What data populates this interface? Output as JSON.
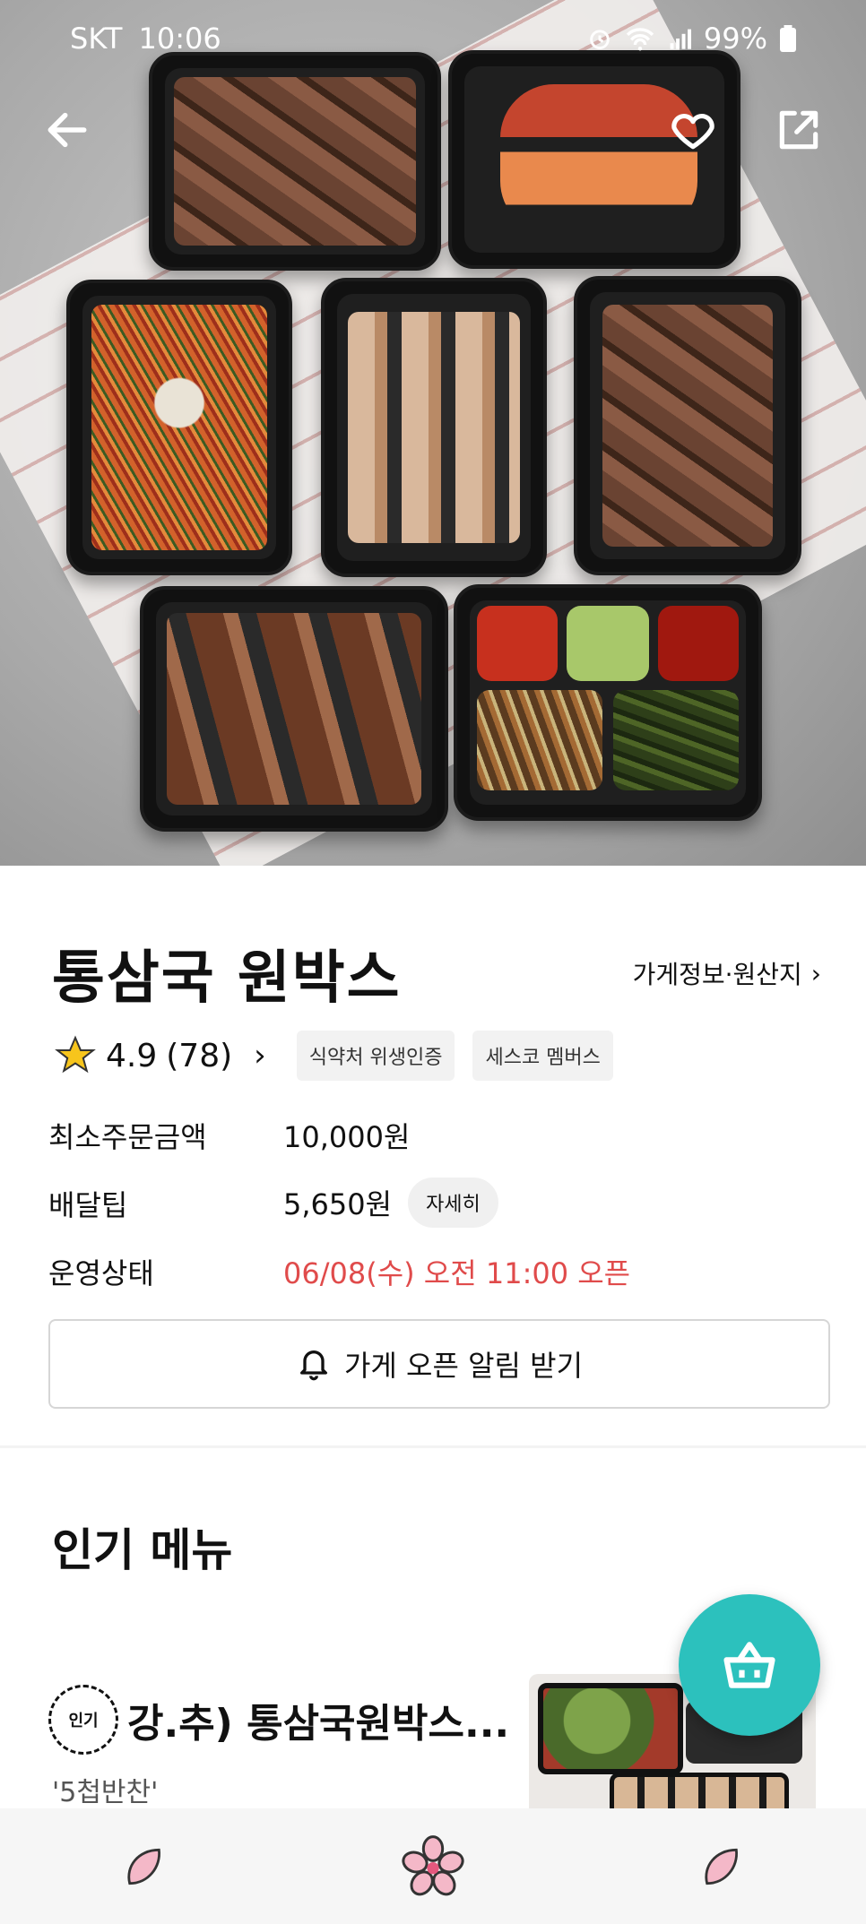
{
  "status_bar": {
    "carrier": "SKT",
    "time": "10:06",
    "battery": "99%",
    "icons": [
      "alarm-icon",
      "wifi-icon",
      "signal-icon",
      "battery-icon"
    ]
  },
  "top_bar": {
    "back_icon": "arrow-left-icon",
    "favorite_icon": "heart-outline-icon",
    "share_icon": "share-icon"
  },
  "store": {
    "name": "통삼국 원박스",
    "info_link": "가게정보·원산지",
    "rating": "4.9",
    "review_count": "(78)",
    "badges": [
      "식약처 위생인증",
      "세스코 멤버스"
    ],
    "details": [
      {
        "label": "최소주문금액",
        "value": "10,000원"
      },
      {
        "label": "배달팁",
        "value": "5,650원",
        "button": "자세히"
      },
      {
        "label": "운영상태",
        "value": "06/08(수) 오전 11:00 오픈"
      }
    ],
    "alarm_button": "가게 오픈 알림 받기"
  },
  "popular": {
    "title": "인기 메뉴",
    "items": [
      {
        "badge": "인기",
        "name": "강.추) 통삼국원박스...",
        "desc": "'5첩반찬'"
      }
    ]
  },
  "colors": {
    "accent_teal": "#2cc1bd",
    "status_red": "#e04b4b",
    "nav_pink": "#f4b8c8"
  },
  "bottom_nav": {
    "items": [
      "petal-icon",
      "cherry-blossom-icon",
      "petal-icon"
    ]
  }
}
